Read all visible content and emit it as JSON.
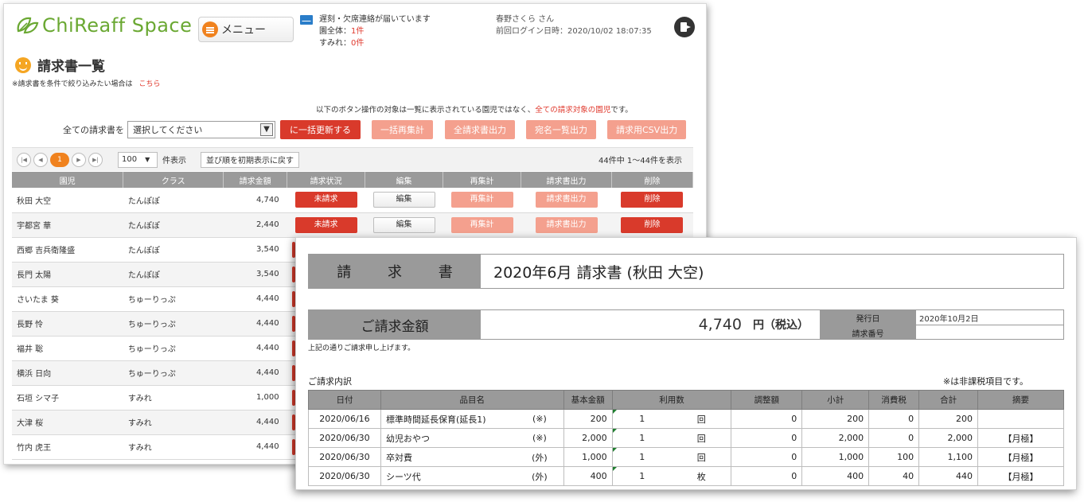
{
  "app": {
    "logo_text": "ChiReaff Space",
    "menu_label": "メニュー",
    "notice_line1": "遅刻・欠席連絡が届いています",
    "notice_line2_label": "園全体：",
    "notice_line2_value": "1件",
    "notice_line3_label": "すみれ：",
    "notice_line3_value": "0件",
    "user_name": "春野さくら さん",
    "last_login": "前回ログイン日時：2020/10/02 18:07:35"
  },
  "list_page": {
    "title": "請求書一覧",
    "filter_note": "※請求書を条件で絞り込みたい場合は",
    "filter_link": "こちら",
    "target_note_prefix": "以下のボタン操作の対象は一覧に表示されている園児ではなく、",
    "target_note_red": "全ての請求対象の園児",
    "target_note_suffix": "です。",
    "bulk_label": "全ての請求書を",
    "bulk_select": "選択してください",
    "bulk_buttons": {
      "update": "に一括更新する",
      "recalc": "一括再集計",
      "all_invoice": "全請求書出力",
      "address_list": "宛名一覧出力",
      "csv": "請求用CSV出力"
    },
    "pager": {
      "first": "|◀",
      "prev": "◀",
      "current": "1",
      "next": "▶",
      "last": "▶|",
      "per_page": "100",
      "per_page_label": "件表示",
      "reset_sort": "並び順を初期表示に戻す",
      "count": "44件中 1～44件を表示"
    },
    "columns": [
      "園児",
      "クラス",
      "請求金額",
      "請求状況",
      "編集",
      "再集計",
      "請求書出力",
      "削除"
    ],
    "actions": {
      "status": "未請求",
      "edit": "編集",
      "recalc": "再集計",
      "output": "請求書出力",
      "delete": "削除"
    },
    "rows": [
      {
        "name": "秋田 大空",
        "class": "たんぽぽ",
        "amount": "4,740"
      },
      {
        "name": "宇都宮 華",
        "class": "たんぽぽ",
        "amount": "2,440"
      },
      {
        "name": "西郷 吉兵衛隆盛",
        "class": "たんぽぽ",
        "amount": "3,540"
      },
      {
        "name": "長門 太陽",
        "class": "たんぽぽ",
        "amount": "3,540"
      },
      {
        "name": "さいたま 葵",
        "class": "ちゅーりっぷ",
        "amount": "4,440"
      },
      {
        "name": "長野 怜",
        "class": "ちゅーりっぷ",
        "amount": "4,440"
      },
      {
        "name": "福井 聡",
        "class": "ちゅーりっぷ",
        "amount": "4,440"
      },
      {
        "name": "横浜 日向",
        "class": "ちゅーりっぷ",
        "amount": "4,440"
      },
      {
        "name": "石垣 シマ子",
        "class": "すみれ",
        "amount": "1,000"
      },
      {
        "name": "大津 桜",
        "class": "すみれ",
        "amount": "4,440"
      },
      {
        "name": "竹内 虎王",
        "class": "すみれ",
        "amount": "4,440"
      }
    ]
  },
  "invoice": {
    "doc_label": "請 求 書",
    "doc_title": "2020年6月 請求書 (秋田 大空)",
    "amount_label": "ご請求金額",
    "amount": "4,740",
    "amount_unit": "円（税込）",
    "issue_date_label": "発行日",
    "issue_date": "2020年10月2日",
    "invoice_no_label": "請求番号",
    "invoice_no": "",
    "greeting": "上記の通りご請求申し上げます。",
    "breakdown_label": "ご請求内訳",
    "tax_note": "※は非課税項目です。",
    "columns": [
      "日付",
      "品目名",
      "基本金額",
      "利用数",
      "調整額",
      "小計",
      "消費税",
      "合計",
      "摘要"
    ],
    "items": [
      {
        "date": "2020/06/16",
        "item": "標準時間延長保育(延長1)",
        "mark": "(※)",
        "base": "200",
        "qty": "1",
        "unit": "回",
        "adj": "0",
        "subtotal": "200",
        "tax": "0",
        "total": "200",
        "note": ""
      },
      {
        "date": "2020/06/30",
        "item": "幼児おやつ",
        "mark": "(※)",
        "base": "2,000",
        "qty": "1",
        "unit": "回",
        "adj": "0",
        "subtotal": "2,000",
        "tax": "0",
        "total": "2,000",
        "note": "【月極】"
      },
      {
        "date": "2020/06/30",
        "item": "卒対費",
        "mark": "(外)",
        "base": "1,000",
        "qty": "1",
        "unit": "回",
        "adj": "0",
        "subtotal": "1,000",
        "tax": "100",
        "total": "1,100",
        "note": "【月極】"
      },
      {
        "date": "2020/06/30",
        "item": "シーツ代",
        "mark": "(外)",
        "base": "400",
        "qty": "1",
        "unit": "枚",
        "adj": "0",
        "subtotal": "400",
        "tax": "40",
        "total": "440",
        "note": "【月極】"
      }
    ]
  }
}
